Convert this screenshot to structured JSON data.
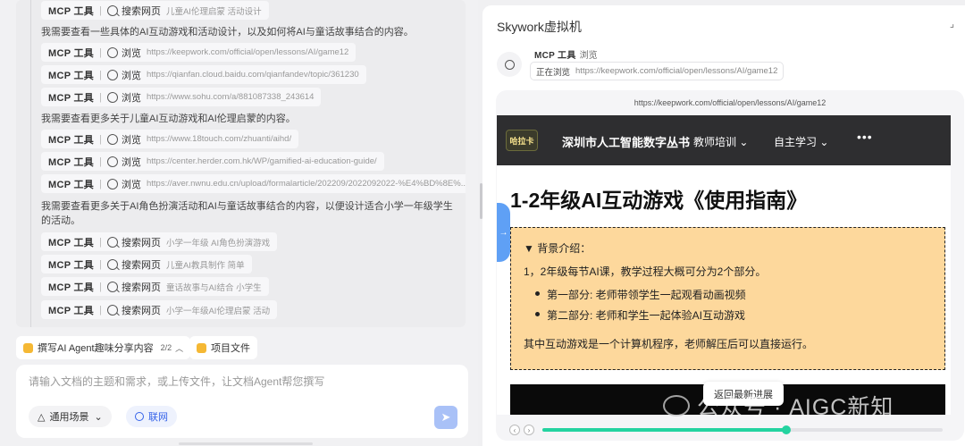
{
  "log": {
    "mcp_label": "MCP 工具",
    "rows": [
      {
        "action": "搜索网页",
        "query": "儿童AI伦理启蒙 活动设计",
        "icon": "search"
      },
      {
        "action": "浏览",
        "query": "https://keepwork.com/official/open/lessons/AI/game12",
        "icon": "browse"
      },
      {
        "action": "浏览",
        "query": "https://qianfan.cloud.baidu.com/qianfandev/topic/361230",
        "icon": "browse"
      },
      {
        "action": "浏览",
        "query": "https://www.sohu.com/a/881087338_243614",
        "icon": "browse"
      },
      {
        "action": "浏览",
        "query": "https://www.18touch.com/zhuanti/aihd/",
        "icon": "browse"
      },
      {
        "action": "浏览",
        "query": "https://center.herder.com.hk/WP/gamified-ai-education-guide/",
        "icon": "browse"
      },
      {
        "action": "浏览",
        "query": "https://aver.nwnu.edu.cn/upload/formalarticle/202209/2022092022-%E4%BD%8E%...",
        "icon": "browse"
      },
      {
        "action": "搜索网页",
        "query": "小学一年级 AI角色扮演游戏",
        "icon": "search"
      },
      {
        "action": "搜索网页",
        "query": "儿童AI教具制作 简单",
        "icon": "search"
      },
      {
        "action": "搜索网页",
        "query": "童话故事与AI结合 小学生",
        "icon": "search"
      },
      {
        "action": "搜索网页",
        "query": "小学一年级AI伦理启蒙 活动",
        "icon": "search"
      }
    ],
    "messages": [
      "我需要查看一些具体的AI互动游戏和活动设计，以及如何将AI与童话故事结合的内容。",
      "我需要查看更多关于儿童AI互动游戏和AI伦理启蒙的内容。",
      "我需要查看更多关于AI角色扮演活动和AI与童话故事结合的内容，以便设计适合小学一年级学生的活动。"
    ]
  },
  "chips": {
    "task": "撰写AI Agent趣味分享内容",
    "task_count": "2/2",
    "files": "项目文件"
  },
  "composer": {
    "placeholder": "请输入文档的主题和需求，或上传文件，让文档Agent帮您撰写",
    "scene": "通用场景",
    "net": "联网"
  },
  "vm": {
    "title": "Skywork虚拟机",
    "tool_label": "MCP 工具",
    "tool_action": "浏览",
    "status": "正在浏览",
    "url": "https://keepwork.com/official/open/lessons/AI/game12"
  },
  "site": {
    "logo": "哈拉卡",
    "name": "深圳市人工智能数字丛书",
    "menu1": "教师培训 ⌄",
    "menu2": "自主学习 ⌄",
    "more": "•••",
    "heading": "1-2年级AI互动游戏《使用指南》",
    "callout_title": "▼ 背景介绍：",
    "p1": "1，2年级每节AI课，教学过程大概可分为2个部分。",
    "li1": "第一部分: 老师带领学生一起观看动画视频",
    "li2": "第二部分: 老师和学生一起体验AI互动游戏",
    "p2": "其中互动游戏是一个计算机程序，老师解压后可以直接运行。",
    "tooltip": "返回最新进展"
  },
  "player": {
    "progress": 0.61,
    "accent": "#24d3a0"
  },
  "watermark": "公众号 · AIGC新知"
}
